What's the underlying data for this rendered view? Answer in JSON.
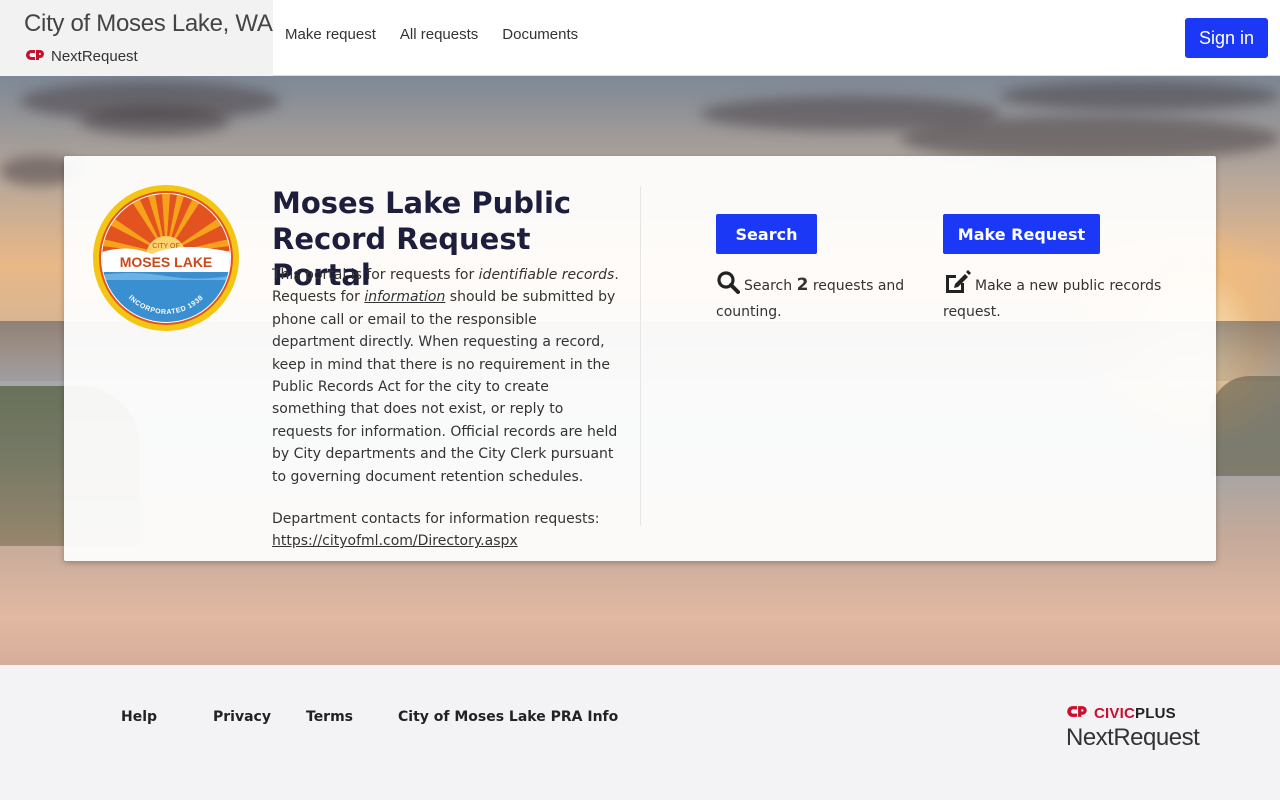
{
  "header": {
    "city_title": "City of Moses Lake, WA",
    "product_name": "NextRequest",
    "nav": [
      "Make request",
      "All requests",
      "Documents"
    ],
    "sign_in": "Sign in"
  },
  "card": {
    "seal_top_text": "CITY OF",
    "seal_name": "MOSES LAKE",
    "seal_bottom_text": "INCORPORATED 1938",
    "title": "Moses Lake Public Record Request Portal",
    "intro_1": "This portal is for requests for ",
    "intro_em": "identifiable records",
    "intro_2": ". Requests for ",
    "intro_u": "information",
    "intro_3": " should be submitted by phone call or email to the responsible department directly. When requesting a record, keep in mind that there is no requirement in the Public Records Act for the city to create something that does not exist, or reply to requests for information. Official records are held by City departments and the City Clerk pursuant to governing document retention schedules.",
    "contacts_label": "Department contacts for information requests:",
    "contacts_link": "https://cityofml.com/Directory.aspx",
    "search_button": "Search",
    "search_desc_pre": "Search ",
    "search_count": "2",
    "search_desc_post": " requests and counting.",
    "make_button": "Make Request",
    "make_desc": "Make a new public records request."
  },
  "footer": {
    "links": [
      "Help",
      "Privacy",
      "Terms",
      "City of Moses Lake PRA Info"
    ],
    "civic_prefix": "CIVIC",
    "civic_suffix": "PLUS",
    "civic_product": "NextRequest"
  },
  "colors": {
    "primary": "#1a38f5",
    "title": "#1c1e3c",
    "logo_red": "#c8102e"
  }
}
